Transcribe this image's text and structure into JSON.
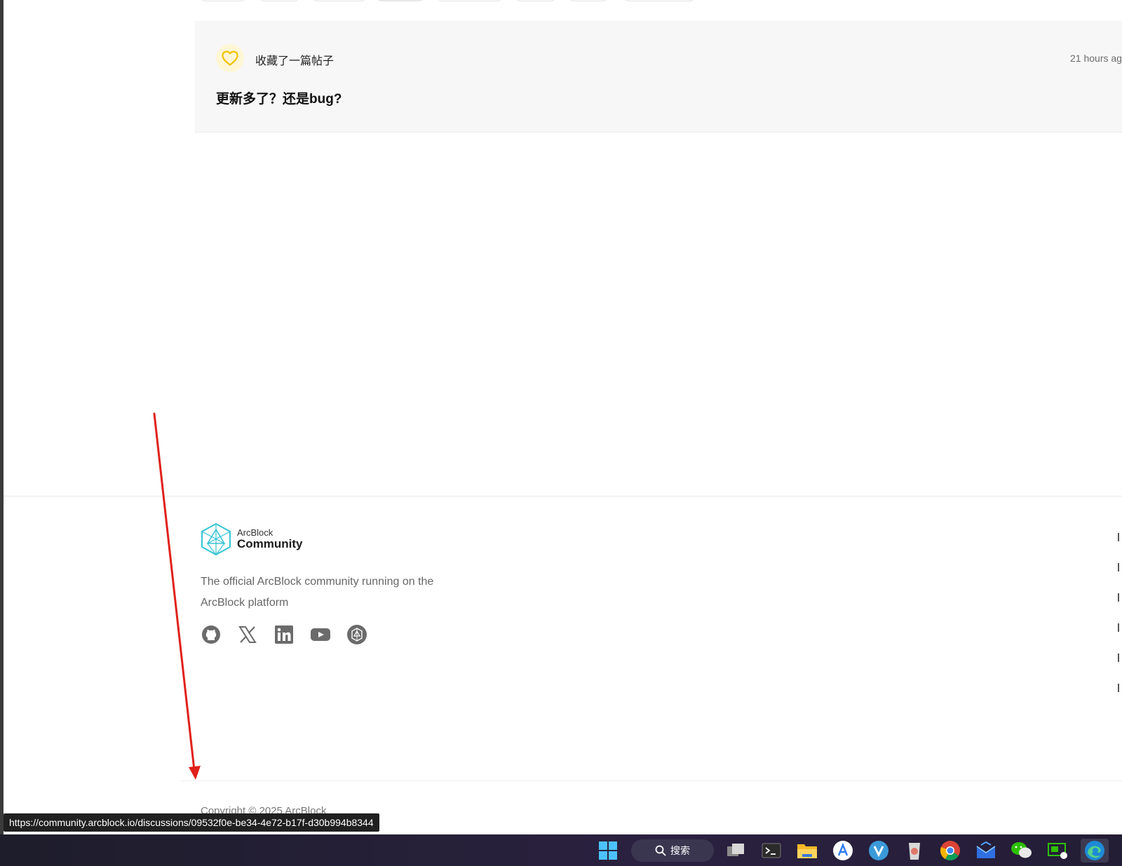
{
  "card": {
    "action": "收藏了一篇帖子",
    "time": "21 hours ag",
    "title": "更新多了？还是bug?"
  },
  "footer": {
    "logo_small": "ArcBlock",
    "logo_big": "Community",
    "description": "The official ArcBlock community running on the ArcBlock platform",
    "socials": [
      "github-icon",
      "x-icon",
      "linkedin-icon",
      "youtube-icon",
      "arcblock-icon"
    ],
    "copyright": "Copyright © 2025 ArcBlock"
  },
  "status_url": "https://community.arcblock.io/discussions/09532f0e-be34-4e72-b17f-d30b994b8344",
  "taskbar": {
    "search_label": "搜索",
    "apps": [
      "windows-start-icon",
      "task-view-icon",
      "terminal-icon",
      "file-explorer-icon",
      "app-store-icon",
      "vivaldi-icon",
      "app-icon",
      "chrome-icon",
      "mail-icon",
      "wechat-icon",
      "remote-desktop-icon",
      "edge-icon"
    ]
  },
  "colors": {
    "heart": "#f2c200",
    "annotation_arrow": "#e0211b",
    "logo_teal": "#35c4d6",
    "social_gray": "#6b6b6b"
  }
}
